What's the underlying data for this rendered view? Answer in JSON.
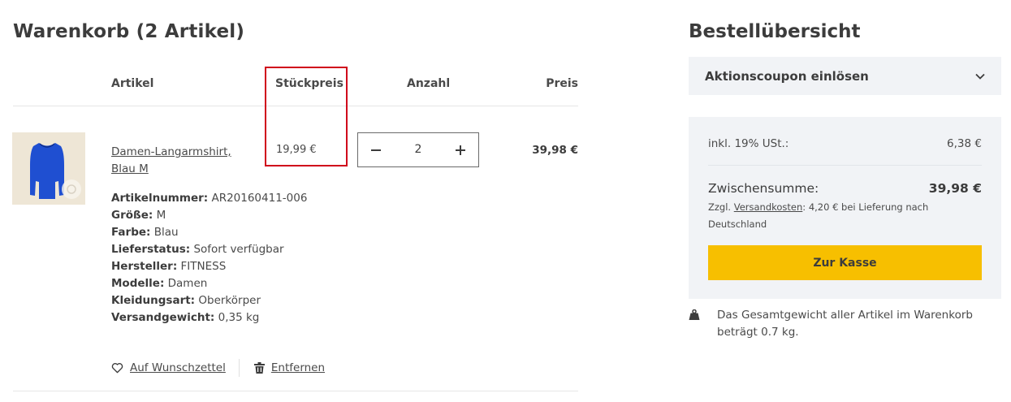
{
  "cart": {
    "title": "Warenkorb (2 Artikel)",
    "headers": {
      "artikel": "Artikel",
      "stueckpreis": "Stückpreis",
      "anzahl": "Anzahl",
      "preis": "Preis"
    },
    "item": {
      "name_line1": "Damen-Langarmshirt,",
      "name_line2": "Blau M",
      "unit_price": "19,99 €",
      "quantity": "2",
      "total_price": "39,98 €",
      "details": [
        {
          "label": "Artikelnummer:",
          "value": "AR20160411-006"
        },
        {
          "label": "Größe:",
          "value": "M"
        },
        {
          "label": "Farbe:",
          "value": "Blau"
        },
        {
          "label": "Lieferstatus:",
          "value": "Sofort verfügbar"
        },
        {
          "label": "Hersteller:",
          "value": "FITNESS"
        },
        {
          "label": "Modelle:",
          "value": "Damen"
        },
        {
          "label": "Kleidungsart:",
          "value": "Oberkörper"
        },
        {
          "label": "Versandgewicht:",
          "value": "0,35 kg"
        }
      ],
      "actions": {
        "wishlist": "Auf Wunschzettel",
        "remove": "Entfernen"
      }
    }
  },
  "summary": {
    "title": "Bestellübersicht",
    "coupon_label": "Aktionscoupon einlösen",
    "tax_label": "inkl. 19% USt.:",
    "tax_value": "6,38 €",
    "subtotal_label": "Zwischensumme:",
    "subtotal_value": "39,98 €",
    "shipping_prefix": "Zzgl.",
    "shipping_link": "Versandkosten",
    "shipping_suffix": ": 4,20 € bei Lieferung nach Deutschland",
    "checkout_label": "Zur Kasse",
    "weight_note": "Das Gesamtgewicht aller Artikel im Warenkorb beträgt 0.7 kg."
  },
  "colors": {
    "accent": "#f7bf00",
    "highlight": "#d0021b",
    "panel": "#f1f3f6",
    "product": "#1f4fd1"
  },
  "icons": {
    "coupon": "chevron-down-icon",
    "minus": "minus-icon",
    "plus": "plus-icon",
    "wishlist": "heart-icon",
    "remove": "trash-icon",
    "weight": "weight-icon"
  }
}
